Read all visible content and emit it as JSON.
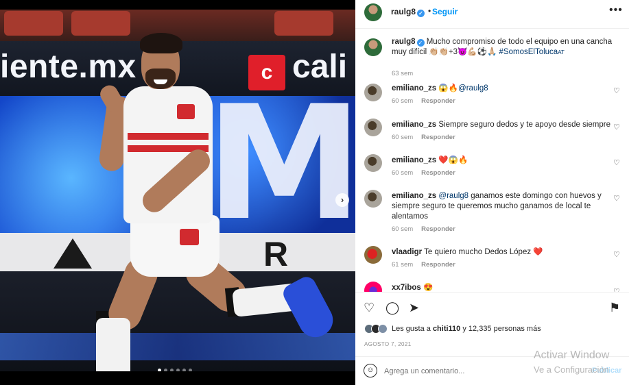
{
  "post": {
    "username": "raulg8",
    "separator": "•",
    "follow_label": "Seguir",
    "more_label": "•••",
    "caption_text": "Mucho compromiso de todo el equipo en una cancha muy difícil 👏🏼👏🏼+3😈💪🏼⚽🙏🏼",
    "caption_hashtag": "#SomosElToluca",
    "caption_tag": "AT",
    "caption_time": "63 sem"
  },
  "photo": {
    "ad_text_left": "iente.mx",
    "ad_logo": "c",
    "ad_text_right": "cali",
    "led_letter": "M",
    "board_letter": "R",
    "next_arrow": "›",
    "dots_count": 6,
    "active_dot": 0
  },
  "comments": [
    {
      "user": "emiliano_zs",
      "text": "😱🔥",
      "mention": "@raulg8",
      "time": "60 sem",
      "reply": "Responder"
    },
    {
      "user": "emiliano_zs",
      "text": "Siempre seguro dedos y te apoyo desde siempre",
      "mention": "",
      "time": "60 sem",
      "reply": "Responder"
    },
    {
      "user": "emiliano_zs",
      "text": "❤️😱🔥",
      "mention": "",
      "time": "60 sem",
      "reply": "Responder"
    },
    {
      "user": "emiliano_zs",
      "text": "ganamos este domingo con huevos y siempre seguro te queremos mucho ganamos de local te alentamos",
      "mention": "@raulg8",
      "time": "60 sem",
      "reply": "Responder"
    },
    {
      "user": "vlaadigr",
      "text": "Te quiero mucho Dedos López ❤️",
      "mention": "",
      "time": "61 sem",
      "reply": "Responder"
    },
    {
      "user": "xx7ibos",
      "text": "😍",
      "mention": "",
      "time": "",
      "reply": ""
    }
  ],
  "actions": {
    "like_icon": "♡",
    "comment_icon": "◯",
    "share_icon": "➤",
    "save_icon": "⚑",
    "likes_prefix": "Les gusta a ",
    "likes_user": "chiti110",
    "likes_suffix": " y 12,335 personas más",
    "date": "AGOSTO 7, 2021"
  },
  "add_comment": {
    "emoji_icon": "☺",
    "placeholder": "Agrega un comentario...",
    "publish_label": "Publicar"
  },
  "watermark": {
    "line1": "Activar Window",
    "line2": "Ve a Configuración"
  },
  "colors": {
    "accent": "#0095f6",
    "verified": "#3897f0",
    "heart": "#e0463a"
  }
}
